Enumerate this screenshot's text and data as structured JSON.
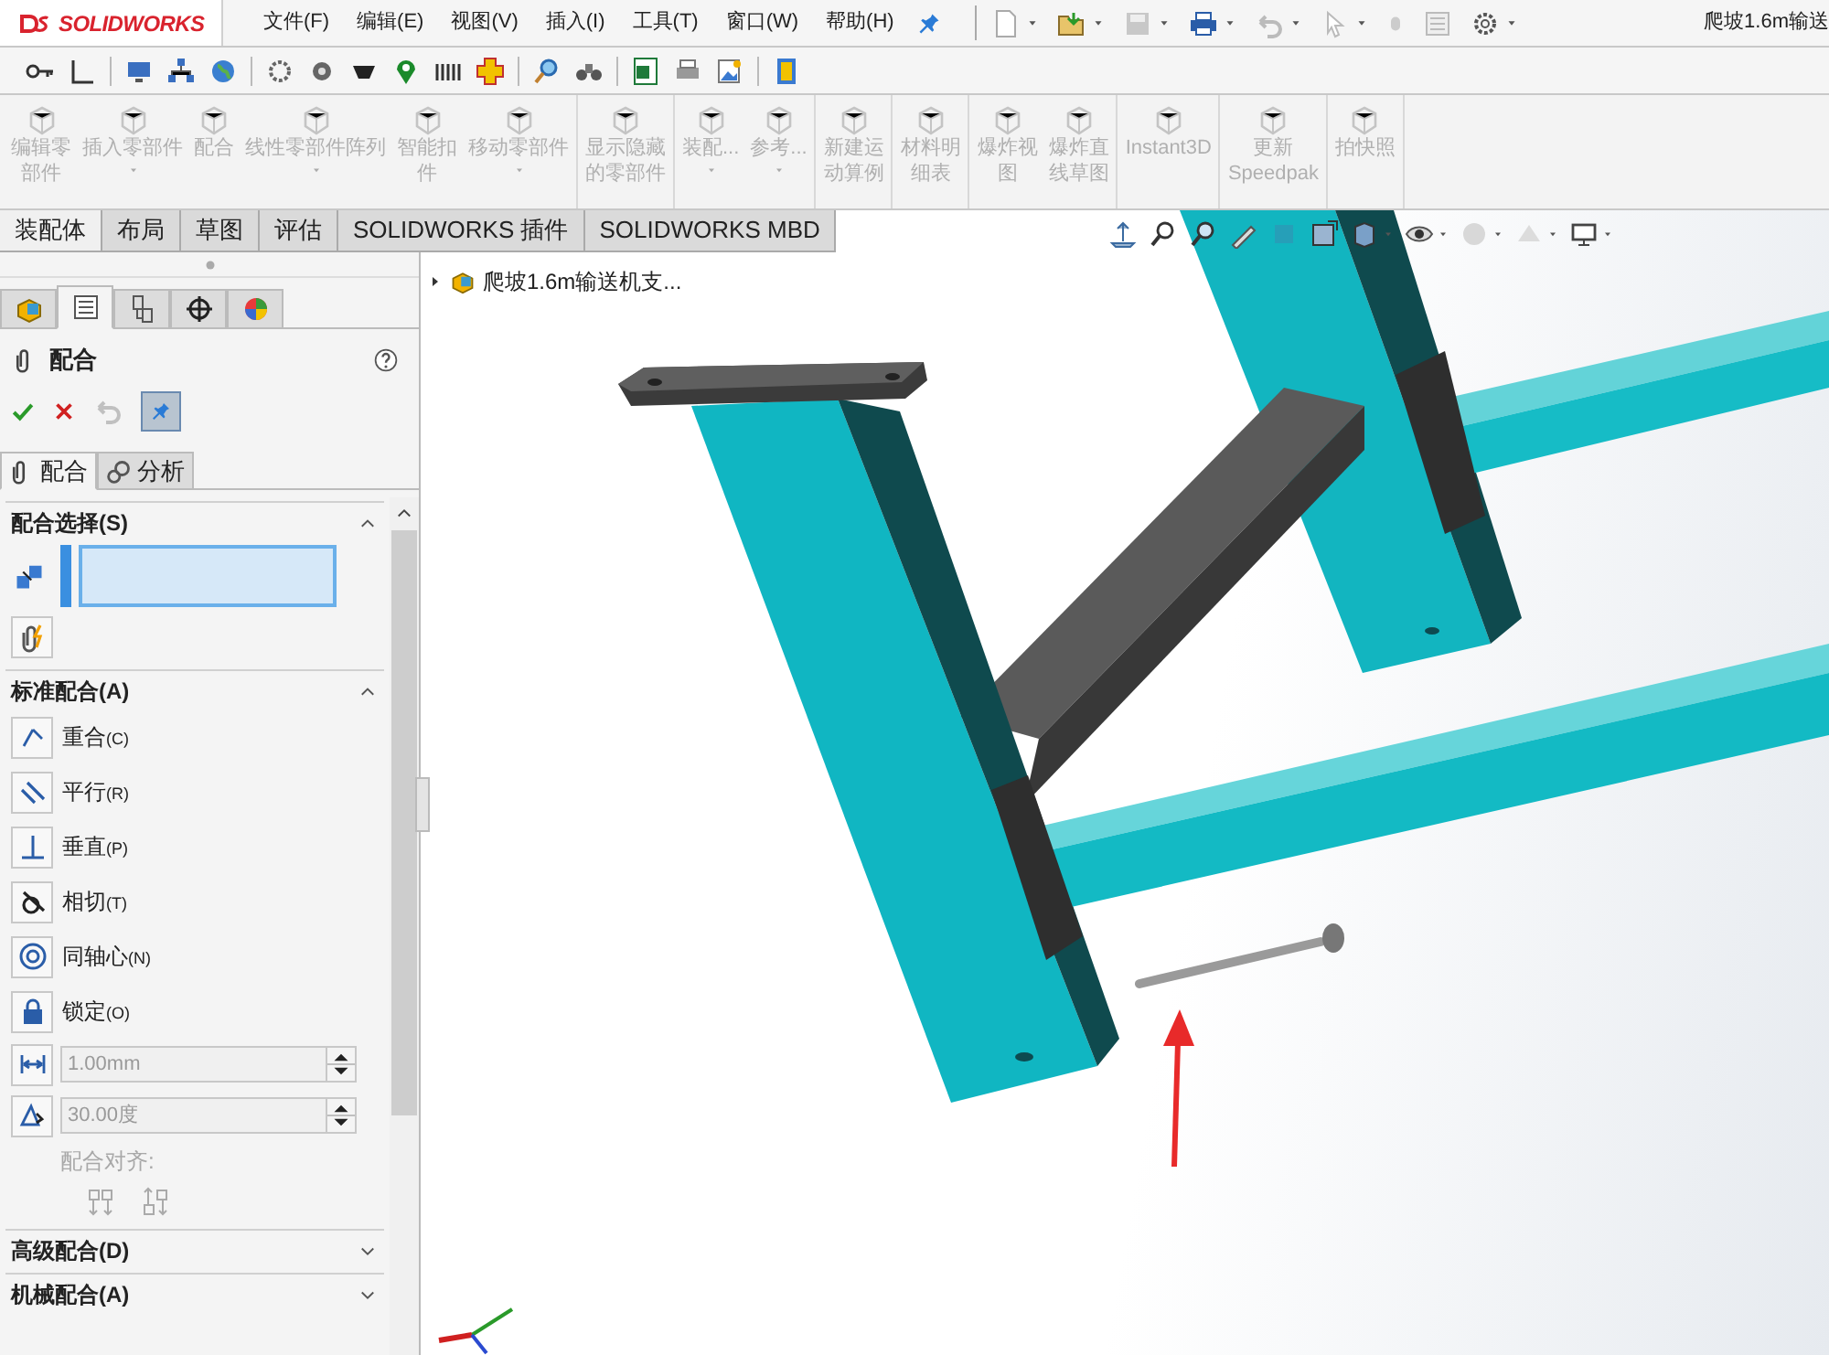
{
  "app": {
    "logo": "SOLIDWORKS"
  },
  "menu": [
    "文件(F)",
    "编辑(E)",
    "视图(V)",
    "插入(I)",
    "工具(T)",
    "窗口(W)",
    "帮助(H)"
  ],
  "title": "爬坡1.6m输送",
  "ribbon_groups": [
    {
      "items": [
        {
          "lines": [
            "编辑零",
            "部件"
          ],
          "dropdown": false,
          "disabled": true
        },
        {
          "lines": [
            "插入零部件"
          ],
          "dropdown": true,
          "disabled": true
        },
        {
          "lines": [
            "配合"
          ],
          "dropdown": false,
          "disabled": true
        },
        {
          "lines": [
            "线性零部件阵列"
          ],
          "dropdown": true,
          "disabled": true
        },
        {
          "lines": [
            "智能扣",
            "件"
          ],
          "dropdown": false,
          "disabled": true
        },
        {
          "lines": [
            "移动零部件"
          ],
          "dropdown": true,
          "disabled": true
        }
      ]
    },
    {
      "items": [
        {
          "lines": [
            "显示隐藏",
            "的零部件"
          ],
          "dropdown": false,
          "disabled": true
        }
      ]
    },
    {
      "items": [
        {
          "lines": [
            "装配..."
          ],
          "dropdown": true,
          "disabled": true
        },
        {
          "lines": [
            "参考..."
          ],
          "dropdown": true,
          "disabled": true
        }
      ]
    },
    {
      "items": [
        {
          "lines": [
            "新建运",
            "动算例"
          ],
          "dropdown": false,
          "disabled": true
        }
      ]
    },
    {
      "items": [
        {
          "lines": [
            "材料明",
            "细表"
          ],
          "dropdown": false,
          "disabled": true
        }
      ]
    },
    {
      "items": [
        {
          "lines": [
            "爆炸视",
            "图"
          ],
          "dropdown": false,
          "disabled": true
        },
        {
          "lines": [
            "爆炸直",
            "线草图"
          ],
          "dropdown": false,
          "disabled": true
        }
      ]
    },
    {
      "items": [
        {
          "lines": [
            "Instant3D"
          ],
          "dropdown": false,
          "disabled": true
        }
      ]
    },
    {
      "items": [
        {
          "lines": [
            "更新",
            "Speedpak"
          ],
          "dropdown": false,
          "disabled": true
        }
      ]
    },
    {
      "items": [
        {
          "lines": [
            "拍快照"
          ],
          "dropdown": false,
          "disabled": true
        }
      ]
    }
  ],
  "tabs": [
    {
      "label": "装配体",
      "selected": true
    },
    {
      "label": "布局",
      "selected": false
    },
    {
      "label": "草图",
      "selected": false
    },
    {
      "label": "评估",
      "selected": false
    },
    {
      "label": "SOLIDWORKS 插件",
      "selected": false
    },
    {
      "label": "SOLIDWORKS MBD",
      "selected": false
    }
  ],
  "panel_tabs": [
    {
      "kind": "feature_tree",
      "selected": false
    },
    {
      "kind": "property_manager",
      "selected": true
    },
    {
      "kind": "configuration",
      "selected": false
    },
    {
      "kind": "dimxpert",
      "selected": false
    },
    {
      "kind": "display",
      "selected": false
    }
  ],
  "property_manager": {
    "title": "配合",
    "subtabs": [
      {
        "label": "配合",
        "selected": true
      },
      {
        "label": "分析",
        "selected": false
      }
    ],
    "sections": [
      {
        "kind": "selection",
        "title": "配合选择(S)",
        "expanded": true
      },
      {
        "kind": "standard",
        "title": "标准配合(A)",
        "expanded": true,
        "mates": [
          {
            "kind": "coincident",
            "label": "重合",
            "shortcut": "(C)"
          },
          {
            "kind": "parallel",
            "label": "平行",
            "shortcut": "(R)"
          },
          {
            "kind": "perpendicular",
            "label": "垂直",
            "shortcut": "(P)"
          },
          {
            "kind": "tangent",
            "label": "相切",
            "shortcut": "(T)"
          },
          {
            "kind": "concentric",
            "label": "同轴心",
            "shortcut": "(N)"
          },
          {
            "kind": "lock",
            "label": "锁定",
            "shortcut": "(O)"
          }
        ],
        "fields": [
          {
            "kind": "distance",
            "value": "1.00mm",
            "disabled": true
          },
          {
            "kind": "angle",
            "value": "30.00度",
            "disabled": true
          }
        ],
        "alignment_label": "配合对齐:"
      },
      {
        "title": "高级配合(D)",
        "expanded": false
      },
      {
        "title": "机械配合(A)",
        "expanded": false
      }
    ]
  },
  "tree": {
    "label": "爬坡1.6m输送机支...",
    "expanded": false
  }
}
